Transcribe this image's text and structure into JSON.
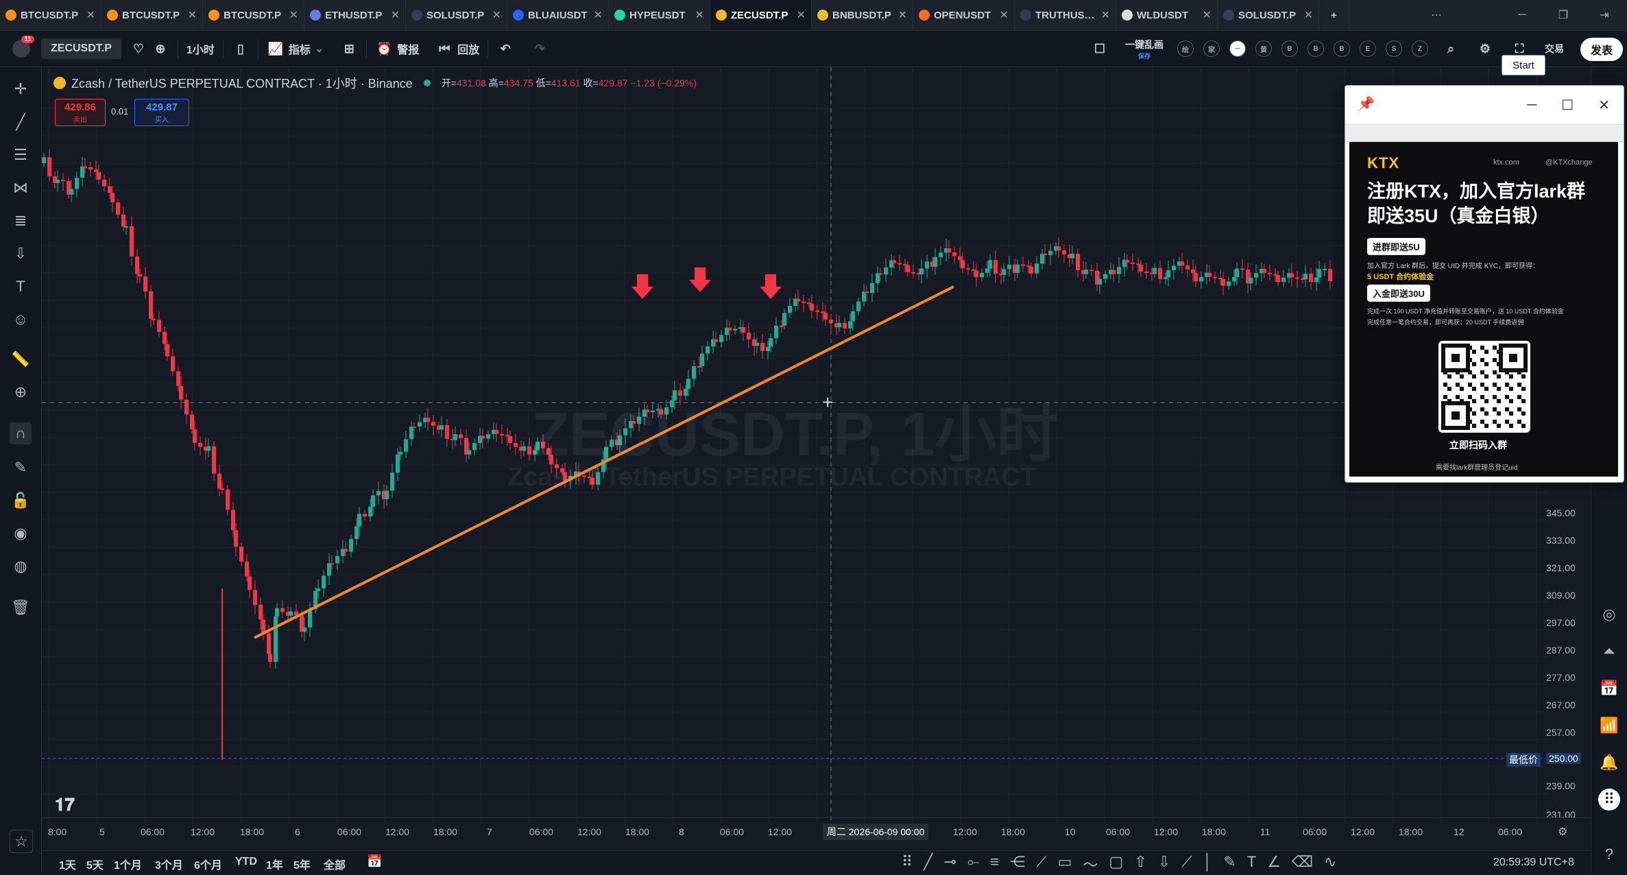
{
  "tabs": [
    {
      "label": "BTCUSDT.P",
      "color": "#f7931a"
    },
    {
      "label": "BTCUSDT.P",
      "color": "#f7931a"
    },
    {
      "label": "BTCUSDT.P",
      "color": "#f7931a"
    },
    {
      "label": "ETHUSDT.P",
      "color": "#627eea"
    },
    {
      "label": "SOLUSDT.P",
      "color": "#3b3b55"
    },
    {
      "label": "BLUAIUSDT",
      "color": "#2962ff"
    },
    {
      "label": "HYPEUSDT",
      "color": "#2bd4a4"
    },
    {
      "label": "ZECUSDT.P",
      "color": "#f4b728",
      "active": true
    },
    {
      "label": "BNBUSDT.P",
      "color": "#f3ba2f"
    },
    {
      "label": "OPENUSDT",
      "color": "#ff6b2b"
    },
    {
      "label": "TRUTHUSDT",
      "color": "#333a55"
    },
    {
      "label": "WLDUSDT",
      "color": "#dddddd"
    },
    {
      "label": "SOLUSDT.P",
      "color": "#3b3b55"
    }
  ],
  "toolbar": {
    "symbol": "ZECUSDT.P",
    "interval": "1小时",
    "indicators": "指标",
    "alerts": "警报",
    "replay": "回放",
    "one_click": "一键乱画",
    "one_click_sub": "保存",
    "trade": "交易",
    "publish": "发表"
  },
  "header": {
    "symbol_title": "Zcash / TetherUS PERPETUAL CONTRACT · 1小时 · Binance",
    "ohlc": [
      {
        "k": "开=",
        "v": "431.08"
      },
      {
        "k": "高=",
        "v": "434.75"
      },
      {
        "k": "低=",
        "v": "413.61"
      },
      {
        "k": "收=",
        "v": "429.87"
      },
      {
        "k": "",
        "v": "−1.23 (−0.29%)"
      }
    ],
    "sell_price": "429.86",
    "sell_label": "卖出",
    "spread": "0.01",
    "buy_price": "429.87",
    "buy_label": "买入"
  },
  "watermark": {
    "symbol": "ZECUSDT.P, 1小时",
    "name": "Zcash / TetherUS PERPETUAL CONTRACT"
  },
  "price_axis": [
    "345.00",
    "333.00",
    "321.00",
    "309.00",
    "297.00",
    "287.00",
    "277.00",
    "267.00",
    "257.00",
    "250.00",
    "239.00",
    "231.00"
  ],
  "lowest_label": "最低价",
  "time_axis": [
    "8:00",
    "5",
    "06:00",
    "12:00",
    "18:00",
    "6",
    "06:00",
    "12:00",
    "18:00",
    "7",
    "06:00",
    "12:00",
    "18:00",
    "8",
    "06:00",
    "12:00",
    "周二 2026-06-09  00:00",
    "12:00",
    "18:00",
    "10",
    "06:00",
    "12:00",
    "18:00",
    "11",
    "06:00",
    "12:00",
    "18:00",
    "12",
    "06:00"
  ],
  "periods": [
    "1天",
    "5天",
    "1个月",
    "3个月",
    "6个月",
    "YTD",
    "1年",
    "5年",
    "全部"
  ],
  "clock": "20:59:39 UTC+8",
  "popup": {
    "brand": "KTX",
    "site": "ktx.com",
    "handle": "@KTXchange",
    "headline1": "注册KTX，加入官方lark群",
    "headline2": "即送35U（真金白银）",
    "pill1": "进群即送5U",
    "desc1": "加入官方 Lark 群后，提交 UID 并完成 KYC，即可获得：",
    "desc1b": "5 USDT 合约体验金",
    "pill2": "入金即送30U",
    "desc2a": "完成一次 100 USDT 净充值并转账至交易账户，送 10 USDT 合约体验金",
    "desc2b": "完成任意一笔合约交易，即可再获：20 USDT 手续费返佣",
    "scan": "立即扫码入群",
    "footer": "需要找lark群管理员登记uid",
    "start": "Start"
  },
  "chart_data": {
    "type": "candlestick",
    "title": "Zcash / TetherUS PERPETUAL CONTRACT · 1小时 · Binance",
    "interval": "1h",
    "price_ticks": [
      345,
      333,
      321,
      309,
      297,
      287,
      277,
      267,
      257,
      250,
      239,
      231
    ],
    "last": {
      "open": 431.08,
      "high": 434.75,
      "low": 413.61,
      "close": 429.87,
      "change": -1.23,
      "change_pct": -0.29
    },
    "trendline": {
      "color": "#f0882a",
      "from": {
        "time": "06-05 17:00",
        "price": 295
      },
      "to": {
        "time": "06-09 02:00",
        "price": 442
      }
    },
    "markers": [
      {
        "type": "arrow-down",
        "color": "#f23645",
        "count": 3
      }
    ],
    "lowest_price": 250.0
  }
}
